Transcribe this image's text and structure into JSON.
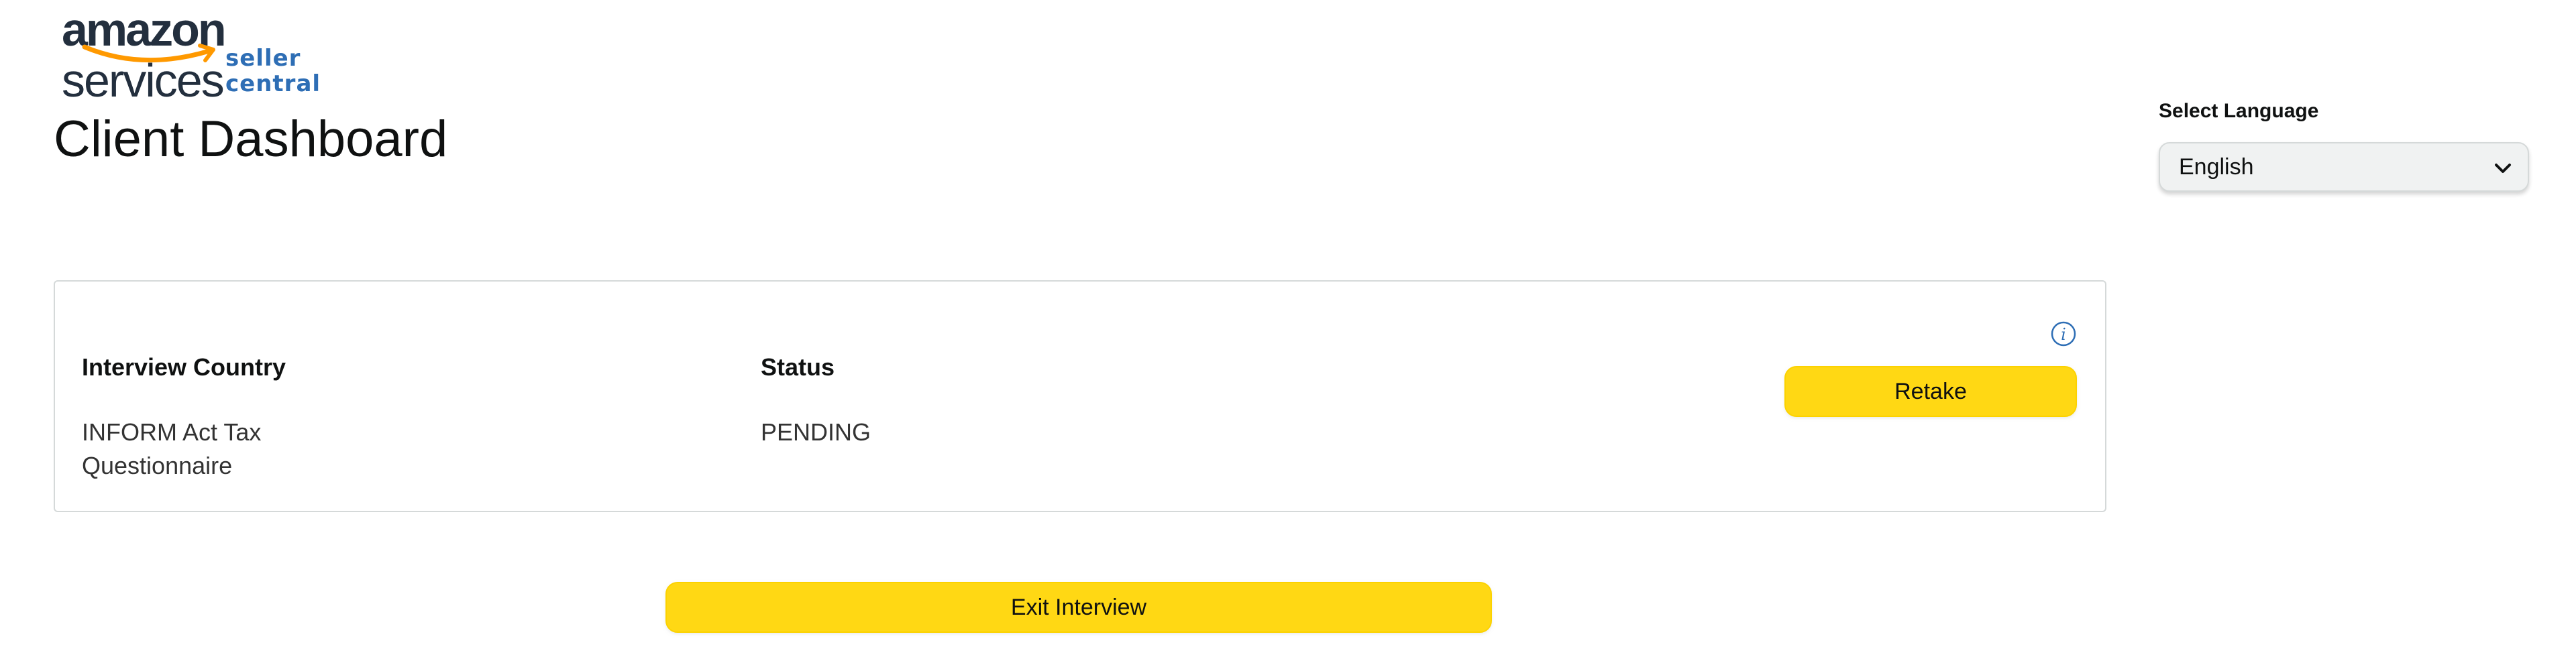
{
  "logo": {
    "wordmark_amazon": "amazon",
    "wordmark_services": "services",
    "subtitle": "seller central",
    "brand_color": "#232f3e",
    "smile_color": "#ff9900",
    "subtitle_color": "#2e6eb5"
  },
  "page": {
    "title": "Client Dashboard"
  },
  "language": {
    "label": "Select Language",
    "selected": "English",
    "icon": "chevron-down-icon"
  },
  "card": {
    "headers": {
      "country": "Interview Country",
      "status": "Status"
    },
    "row": {
      "country_line1": "INFORM Act Tax",
      "country_line2": "Questionnaire",
      "status": "PENDING"
    },
    "info_icon": "info-icon",
    "retake_label": "Retake"
  },
  "footer": {
    "exit_label": "Exit Interview"
  },
  "colors": {
    "button_yellow": "#ffd814",
    "info_blue": "#2e6eb5",
    "border": "#d5d9d9"
  }
}
